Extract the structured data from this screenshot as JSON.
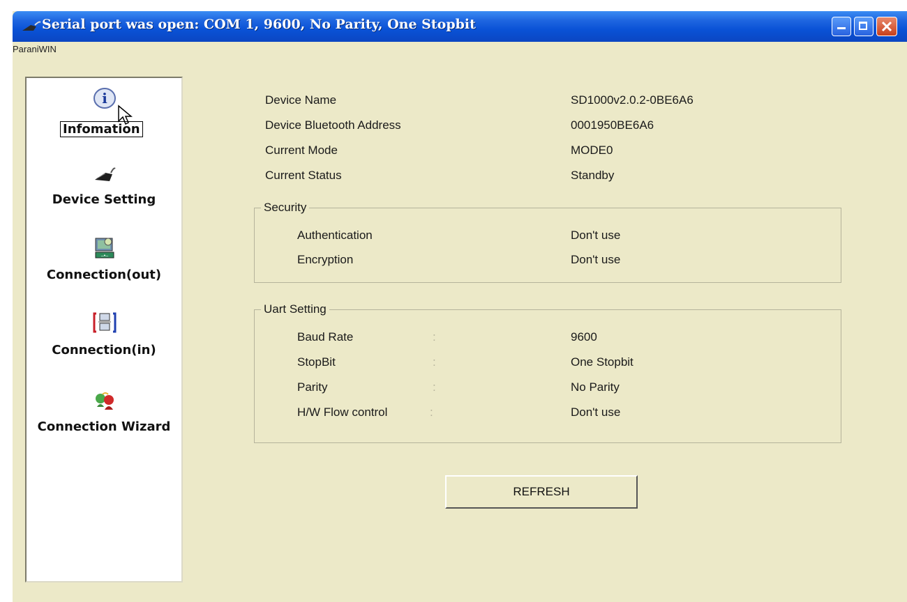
{
  "window": {
    "title": "Serial port was open: COM 1, 9600, No Parity, One Stopbit",
    "menu_label": "ParaniWIN"
  },
  "sidebar": {
    "items": [
      {
        "label": "Infomation",
        "icon": "info-icon",
        "selected": true
      },
      {
        "label": "Device Setting",
        "icon": "device-setting-icon"
      },
      {
        "label": "Connection(out)",
        "icon": "connection-out-icon"
      },
      {
        "label": "Connection(in)",
        "icon": "connection-in-icon"
      },
      {
        "label": "Connection Wizard",
        "icon": "connection-wizard-icon"
      }
    ]
  },
  "info": {
    "device_name_label": "Device Name",
    "device_name_value": "SD1000v2.0.2-0BE6A6",
    "bt_address_label": "Device Bluetooth Address",
    "bt_address_value": "0001950BE6A6",
    "mode_label": "Current Mode",
    "mode_value": "MODE0",
    "status_label": "Current Status",
    "status_value": "Standby"
  },
  "security": {
    "title": "Security",
    "auth_label": "Authentication",
    "auth_value": "Don't use",
    "enc_label": "Encryption",
    "enc_value": "Don't use"
  },
  "uart": {
    "title": "Uart Setting",
    "colon": ":",
    "baud_label": "Baud Rate",
    "baud_value": "9600",
    "stopbit_label": "StopBit",
    "stopbit_value": "One Stopbit",
    "parity_label": "Parity",
    "parity_value": "No Parity",
    "flow_label": "H/W Flow control",
    "flow_value": "Don't use"
  },
  "refresh_label": "REFRESH",
  "colors": {
    "window_bg": "#ece9c8",
    "titlebar": "#0a52d6",
    "close_button": "#c8401c"
  }
}
